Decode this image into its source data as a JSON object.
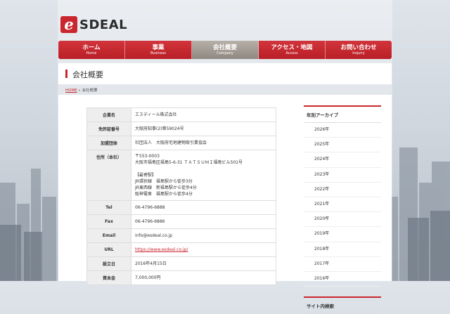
{
  "brand": {
    "name": "SDEAL",
    "mark_color": "#c9262d"
  },
  "nav": [
    {
      "jp": "ホーム",
      "en": "Home"
    },
    {
      "jp": "事業",
      "en": "Business"
    },
    {
      "jp": "会社概要",
      "en": "Company"
    },
    {
      "jp": "アクセス・地図",
      "en": "Access"
    },
    {
      "jp": "お問い合わせ",
      "en": "Inquiry"
    }
  ],
  "page": {
    "title": "会社概要"
  },
  "breadcrumb": {
    "home": "HOME",
    "sep": " » ",
    "current": "会社概要"
  },
  "company": {
    "rows": [
      {
        "key": "企業名",
        "value": "エスディール株式会社"
      },
      {
        "key": "免許証番号",
        "value": "大阪府知事(2)第59024号"
      },
      {
        "key": "加盟団体",
        "value": "社団法人　大阪府宅地建物取引業協会"
      },
      {
        "key": "住所（本社）",
        "value": "〒553-0003\n大阪市福島区福島5-6-31 ＴＡＴＳＵＭＩ福島ビル501号\n\n【最寄駅】\nJR環状線　福島駅から徒歩3分\nJR東西線　新福島駅から徒歩4分\n阪神電車　福島駅から徒歩4分"
      },
      {
        "key": "Tel",
        "value": "06-4796-6888"
      },
      {
        "key": "Fax",
        "value": "06-4796-6886"
      },
      {
        "key": "Email",
        "value": "info@esdeal.co.jp"
      },
      {
        "key": "URL",
        "value": "https://www.esdeal.co.jp/",
        "link": true
      },
      {
        "key": "設立日",
        "value": "2016年4月15日"
      },
      {
        "key": "資本金",
        "value": "7,000,000円"
      }
    ]
  },
  "archive": {
    "title": "年別アーカイブ",
    "years": [
      "2026年",
      "2025年",
      "2024年",
      "2023年",
      "2022年",
      "2021年",
      "2020年",
      "2019年",
      "2018年",
      "2017年",
      "2016年"
    ]
  },
  "sidebar2": {
    "title": "サイト内検索"
  },
  "colors": {
    "accent": "#c9262d",
    "nav_active": "#9e978f"
  }
}
